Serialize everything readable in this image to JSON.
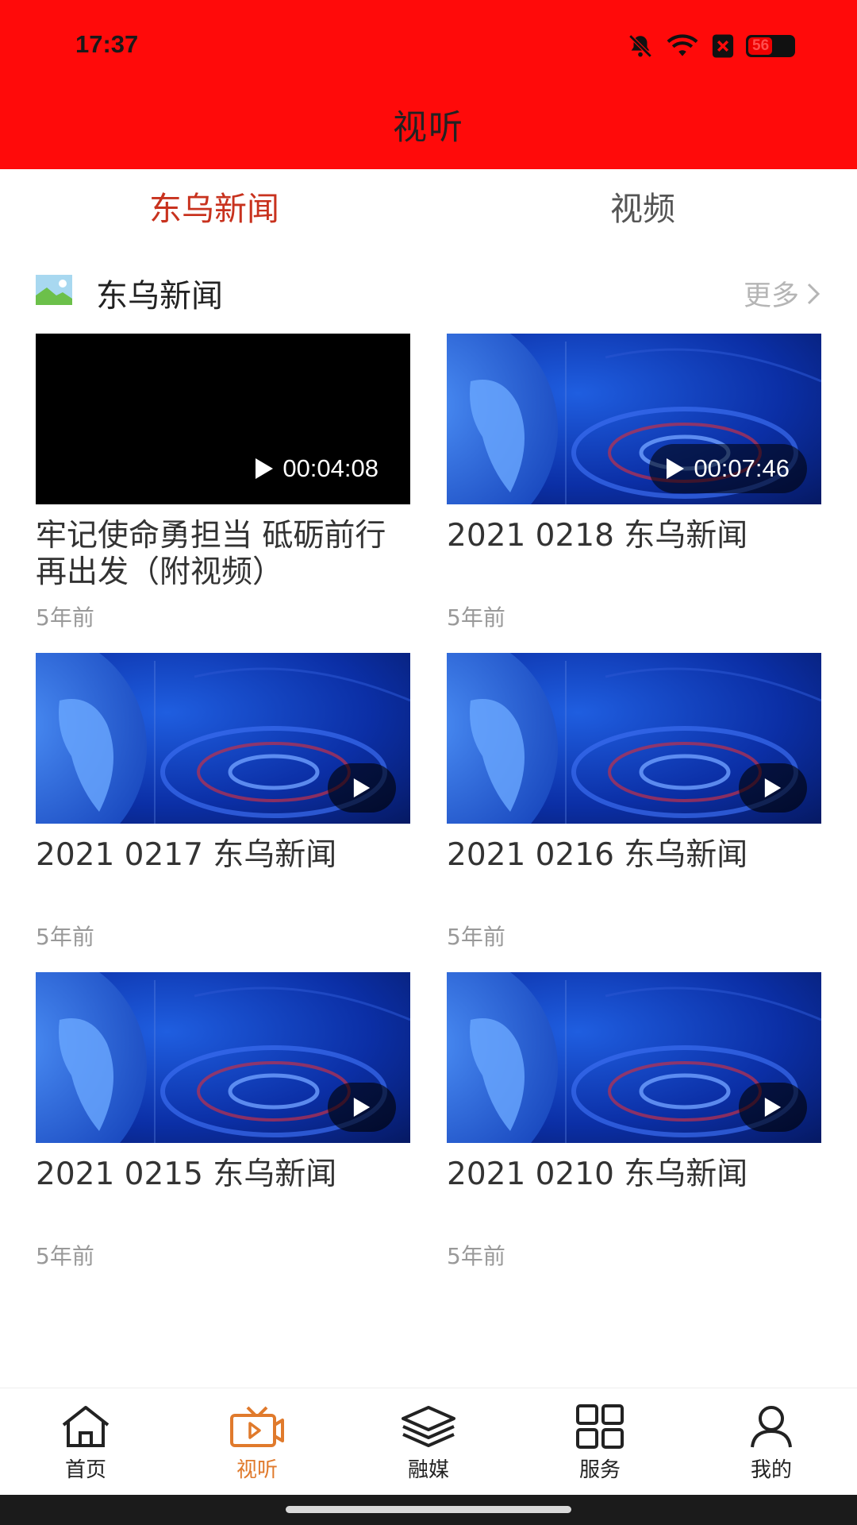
{
  "status_bar": {
    "time": "17:37",
    "battery": "56"
  },
  "header": {
    "title": "视听"
  },
  "tabs": [
    {
      "label": "东乌新闻",
      "active": true
    },
    {
      "label": "视频",
      "active": false
    }
  ],
  "section": {
    "title": "东乌新闻",
    "more_label": "更多"
  },
  "videos": [
    {
      "title": "牢记使命勇担当 砥砺前行再出发（附视频）",
      "time": "5年前",
      "duration": "00:04:08",
      "thumb": "black"
    },
    {
      "title": "2021 0218 东乌新闻",
      "time": "5年前",
      "duration": "00:07:46",
      "thumb": "globe"
    },
    {
      "title": "2021 0217 东乌新闻",
      "time": "5年前",
      "duration": "",
      "thumb": "globe"
    },
    {
      "title": "2021 0216 东乌新闻",
      "time": "5年前",
      "duration": "",
      "thumb": "globe"
    },
    {
      "title": "2021 0215 东乌新闻",
      "time": "5年前",
      "duration": "",
      "thumb": "globe"
    },
    {
      "title": "2021 0210 东乌新闻",
      "time": "5年前",
      "duration": "",
      "thumb": "globe"
    }
  ],
  "bottom_nav": [
    {
      "label": "首页",
      "icon": "home-icon",
      "active": false
    },
    {
      "label": "视听",
      "icon": "tv-icon",
      "active": true
    },
    {
      "label": "融媒",
      "icon": "layers-icon",
      "active": false
    },
    {
      "label": "服务",
      "icon": "grid-icon",
      "active": false
    },
    {
      "label": "我的",
      "icon": "user-icon",
      "active": false
    }
  ],
  "colors": {
    "header_bg": "#ff0a0a",
    "tab_active": "#c8321e",
    "nav_active": "#e07a2c"
  }
}
